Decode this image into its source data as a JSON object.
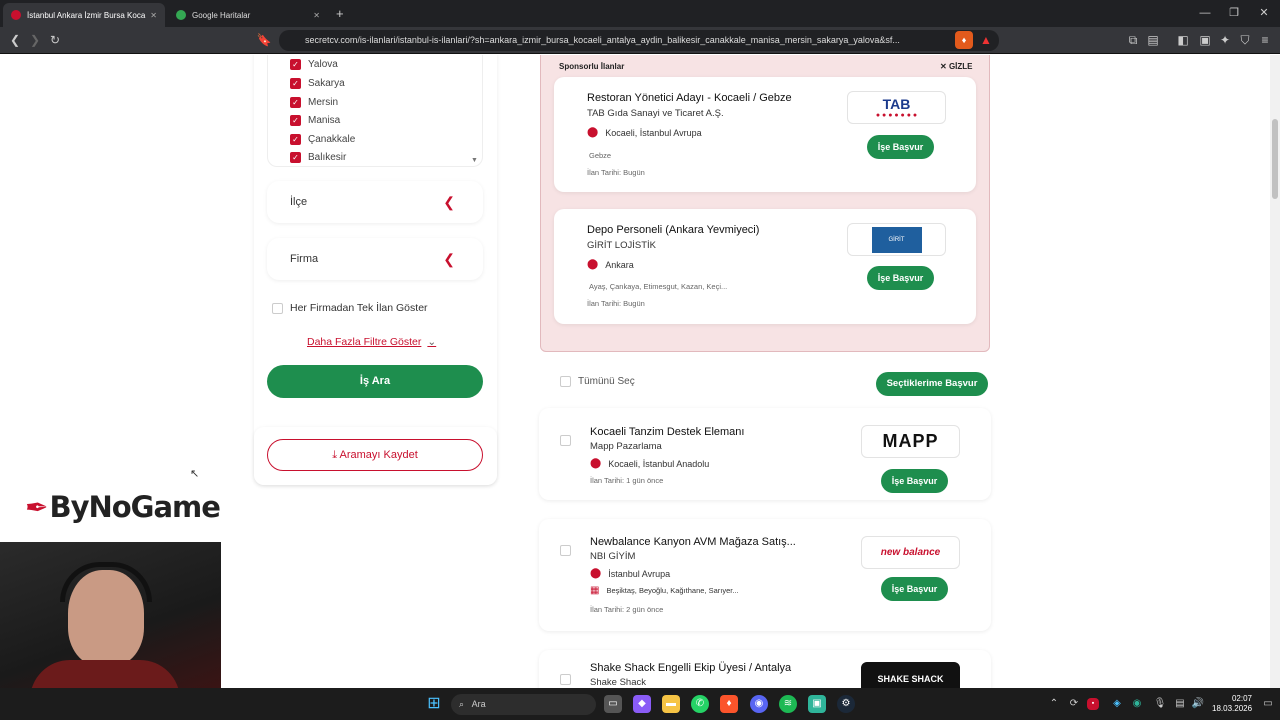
{
  "browser": {
    "tabs": [
      {
        "title": "İstanbul Ankara İzmir Bursa Koca..."
      },
      {
        "title": "Google Haritalar"
      }
    ],
    "new_tab": "+",
    "url": "secretcv.com/is-ilanlari/istanbul-is-ilanlari/?sh=ankara_izmir_bursa_kocaeli_antalya_aydin_balikesir_canakkale_manisa_mersin_sakarya_yalova&sf..."
  },
  "filters": {
    "cities": [
      {
        "label": "Yalova"
      },
      {
        "label": "Sakarya"
      },
      {
        "label": "Mersin"
      },
      {
        "label": "Manisa"
      },
      {
        "label": "Çanakkale"
      },
      {
        "label": "Balıkesir"
      }
    ],
    "district_label": "İlçe",
    "company_label": "Firma",
    "one_per_company": "Her Firmadan Tek İlan Göster",
    "more_filters": "Daha Fazla Filtre Göster",
    "search_button": "İş Ara",
    "save_search": "Aramayı Kaydet"
  },
  "sponsored": {
    "heading": "Sponsorlu İlanlar",
    "hide": "GİZLE",
    "jobs": [
      {
        "title": "Restoran Yönetici Adayı - Kocaeli / Gebze",
        "company": "TAB Gıda Sanayi ve Ticaret A.Ş.",
        "location": "Kocaeli, İstanbul Avrupa",
        "district": "Gebze",
        "date": "İlan Tarihi: Bugün",
        "apply": "İşe Başvur",
        "logo_text": "TAB"
      },
      {
        "title": "Depo Personeli (Ankara Yevmiyeci)",
        "company": "GİRİT LOJİSTİK",
        "location": "Ankara",
        "district": "Ayaş, Çankaya, Etimesgut, Kazan, Keçi...",
        "date": "İlan Tarihi: Bugün",
        "apply": "İşe Başvur",
        "logo_text": "GİRİT"
      }
    ]
  },
  "list": {
    "select_all": "Tümünü Seç",
    "apply_selected": "Seçtiklerime Başvur",
    "jobs": [
      {
        "title": "Kocaeli Tanzim Destek Elemanı",
        "company": "Mapp Pazarlama",
        "location": "Kocaeli, İstanbul Anadolu",
        "date": "İlan Tarihi: 1 gün önce",
        "apply": "İşe Başvur",
        "logo_text": "MAPP"
      },
      {
        "title": "Newbalance Kanyon AVM Mağaza Satış...",
        "company": "NBI GİYİM",
        "location": "İstanbul Avrupa",
        "district": "Beşiktaş, Beyoğlu, Kağıthane, Sarıyer...",
        "date": "İlan Tarihi: 2 gün önce",
        "apply": "İşe Başvur",
        "logo_text": "new balance"
      },
      {
        "title": "Shake Shack Engelli Ekip Üyesi / Antalya",
        "company": "Shake Shack",
        "logo_text": "SHAKE SHACK"
      }
    ]
  },
  "overlay": {
    "brand": "ByNoGame"
  },
  "taskbar": {
    "search": "Ara",
    "time": "02:07",
    "date": "18.03.2026"
  }
}
